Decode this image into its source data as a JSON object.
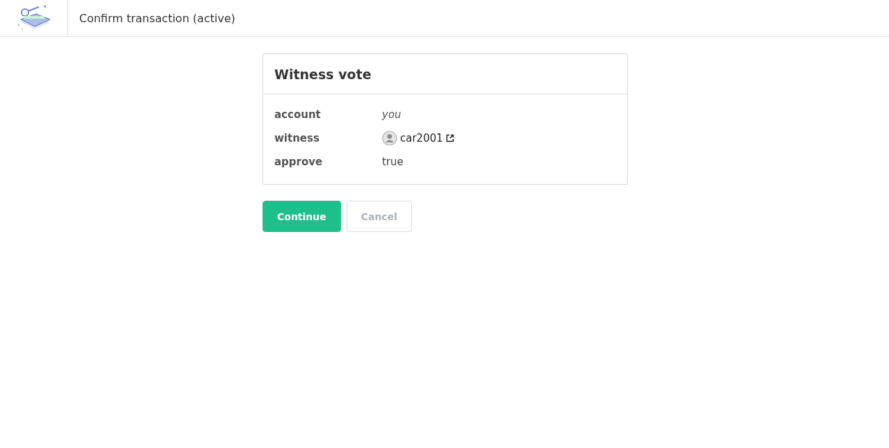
{
  "header": {
    "title": "Confirm transaction (active)"
  },
  "card": {
    "title": "Witness vote",
    "fields": [
      {
        "label": "account",
        "value": "you",
        "kind": "italic"
      },
      {
        "label": "witness",
        "value": "car2001",
        "kind": "user"
      },
      {
        "label": "approve",
        "value": "true",
        "kind": "plain"
      }
    ]
  },
  "buttons": [
    {
      "label": "Continue",
      "kind": "primary",
      "disabled": false
    },
    {
      "label": "Cancel",
      "kind": "secondary",
      "disabled": true
    }
  ]
}
